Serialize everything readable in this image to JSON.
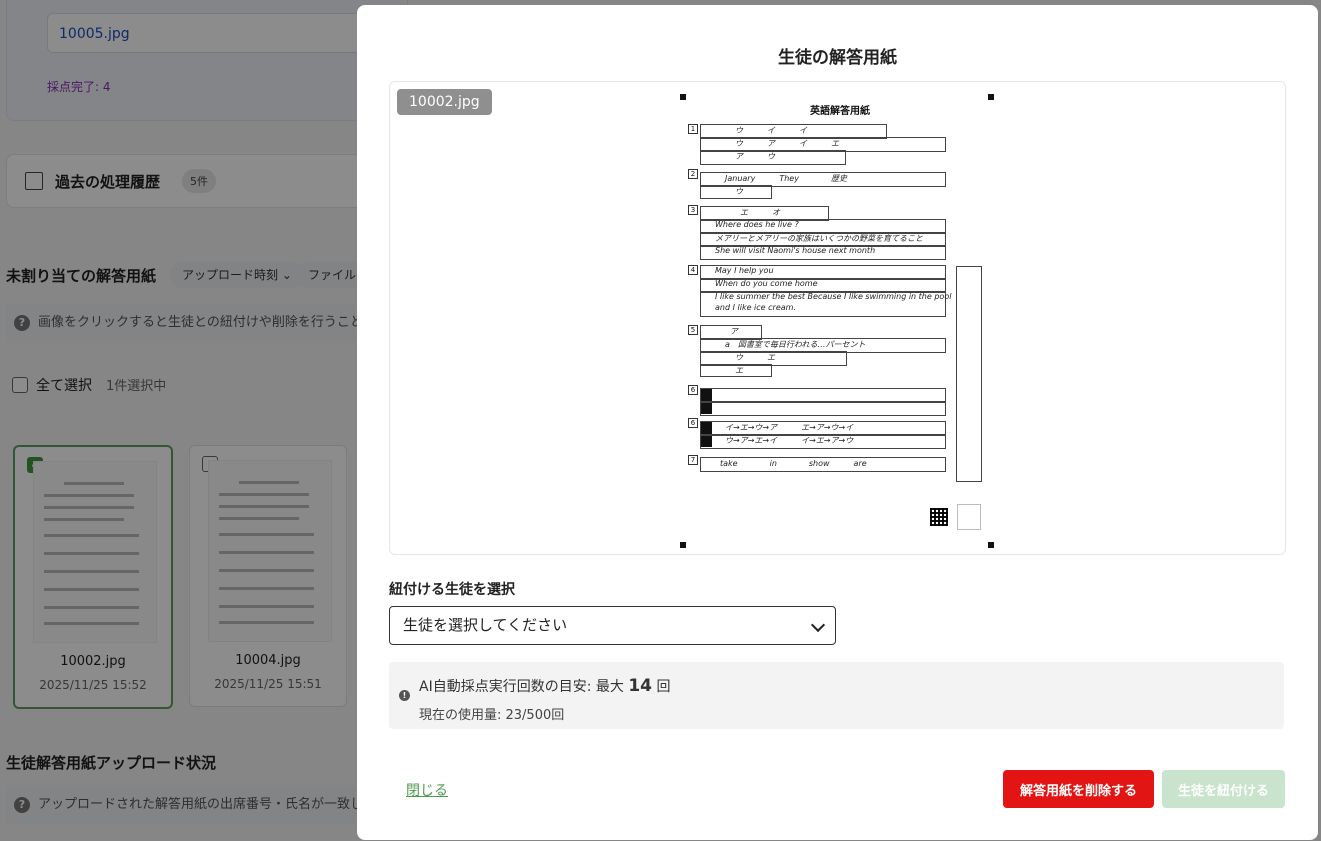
{
  "background": {
    "top_file": "10005.jpg",
    "scored_status": "採点完了: 4",
    "history": {
      "title": "過去の処理履歴",
      "count": "5件"
    },
    "unassigned": {
      "title": "未割り当ての解答用紙",
      "sort_options": [
        "アップロード時刻",
        "ファイル名"
      ],
      "hint": "画像をクリックすると生徒との紐付けや削除を行うことができます",
      "select_all": "全て選択",
      "selected_count": "1件選択中",
      "thumbnails": [
        {
          "name": "10002.jpg",
          "date": "2025/11/25 15:52",
          "selected": true
        },
        {
          "name": "10004.jpg",
          "date": "2025/11/25 15:51",
          "selected": false
        }
      ]
    },
    "upload_status": {
      "title": "生徒解答用紙アップロード状況",
      "hint": "アップロードされた解答用紙の出席番号・氏名が一致しているか確認してください"
    }
  },
  "modal": {
    "title": "生徒の解答用紙",
    "preview_badge": "10002.jpg",
    "sheet_title": "英語解答用紙",
    "select_label": "紐付ける生徒を選択",
    "select_value": "生徒を選択してください",
    "info": {
      "line1_prefix": "AI自動採点実行回数の目安: 最大",
      "line1_number": "14",
      "line1_suffix": "回",
      "line2": "現在の使用量: 23/500回"
    },
    "close_label": "閉じる",
    "delete_label": "解答用紙を削除する",
    "link_label": "生徒を紐付ける"
  },
  "colors": {
    "delete": "#e31414",
    "link_disabled": "#c9e3cc",
    "accent_green": "#4f9a4f"
  }
}
